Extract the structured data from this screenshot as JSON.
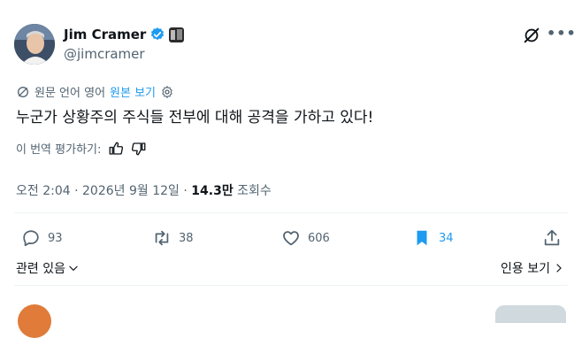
{
  "author": {
    "name": "Jim Cramer",
    "handle": "@jimcramer",
    "verified_color": "#1d9bf0"
  },
  "translation": {
    "original_lang_label": "원문 언어 영어",
    "show_original": "원본 보기"
  },
  "tweet": {
    "text": "누군가 상황주의 주식들 전부에 대해 공격을 가하고 있다!"
  },
  "rate": {
    "label": "이 번역 평가하기:"
  },
  "meta": {
    "time": "오전 2:04",
    "sep": "·",
    "date": "2026년 9월 12일",
    "views_count": "14.3만",
    "views_label": "조회수"
  },
  "actions": {
    "replies": "93",
    "retweets": "38",
    "likes": "606",
    "bookmarks": "34"
  },
  "footer": {
    "related": "관련 있음",
    "view_quotes": "인용 보기"
  },
  "colors": {
    "accent": "#1d9bf0",
    "muted": "#536471",
    "text": "#0f1419"
  }
}
